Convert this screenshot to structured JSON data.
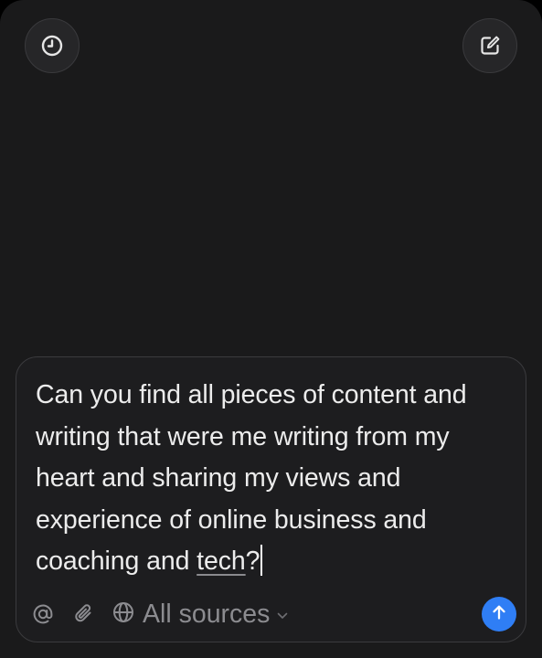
{
  "header": {
    "history_icon": "clock-icon",
    "compose_icon": "compose-icon"
  },
  "composer": {
    "prompt_text": "Can you find all pieces of content and writing that were me writing from my heart and sharing my views and experience of online business and coaching and ",
    "prompt_underlined": "tech",
    "prompt_end": "?",
    "toolbar": {
      "mention_icon": "at-icon",
      "attach_icon": "paperclip-icon",
      "sources_icon": "globe-icon",
      "sources_label": "All sources",
      "send_icon": "arrow-up-icon"
    }
  },
  "colors": {
    "background": "#1a1a1b",
    "send_button": "#2f7ef5",
    "muted_text": "#8c8c90"
  }
}
